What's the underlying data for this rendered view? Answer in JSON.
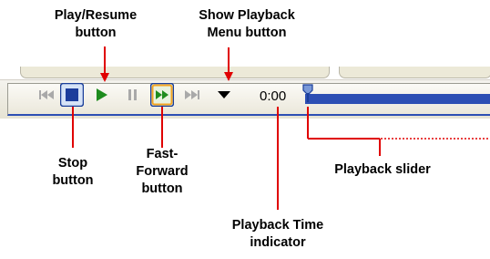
{
  "callouts": {
    "play_resume": [
      "Play/Resume",
      "button"
    ],
    "show_playback_menu": [
      "Show Playback",
      "Menu button"
    ],
    "stop": [
      "Stop",
      "button"
    ],
    "fast_forward": [
      "Fast-",
      "Forward",
      "button"
    ],
    "playback_slider": [
      "Playback slider"
    ],
    "playback_time": [
      "Playback Time",
      "indicator"
    ]
  },
  "toolbar": {
    "time": "0:00",
    "buttons": [
      "previous",
      "stop",
      "play",
      "pause",
      "fast-forward",
      "next",
      "show-playback-menu"
    ]
  },
  "playback": {
    "position": 0
  },
  "colors": {
    "callout_line": "#e00000",
    "accent": "#2d4fb4",
    "play_green": "#1e8c1e"
  }
}
